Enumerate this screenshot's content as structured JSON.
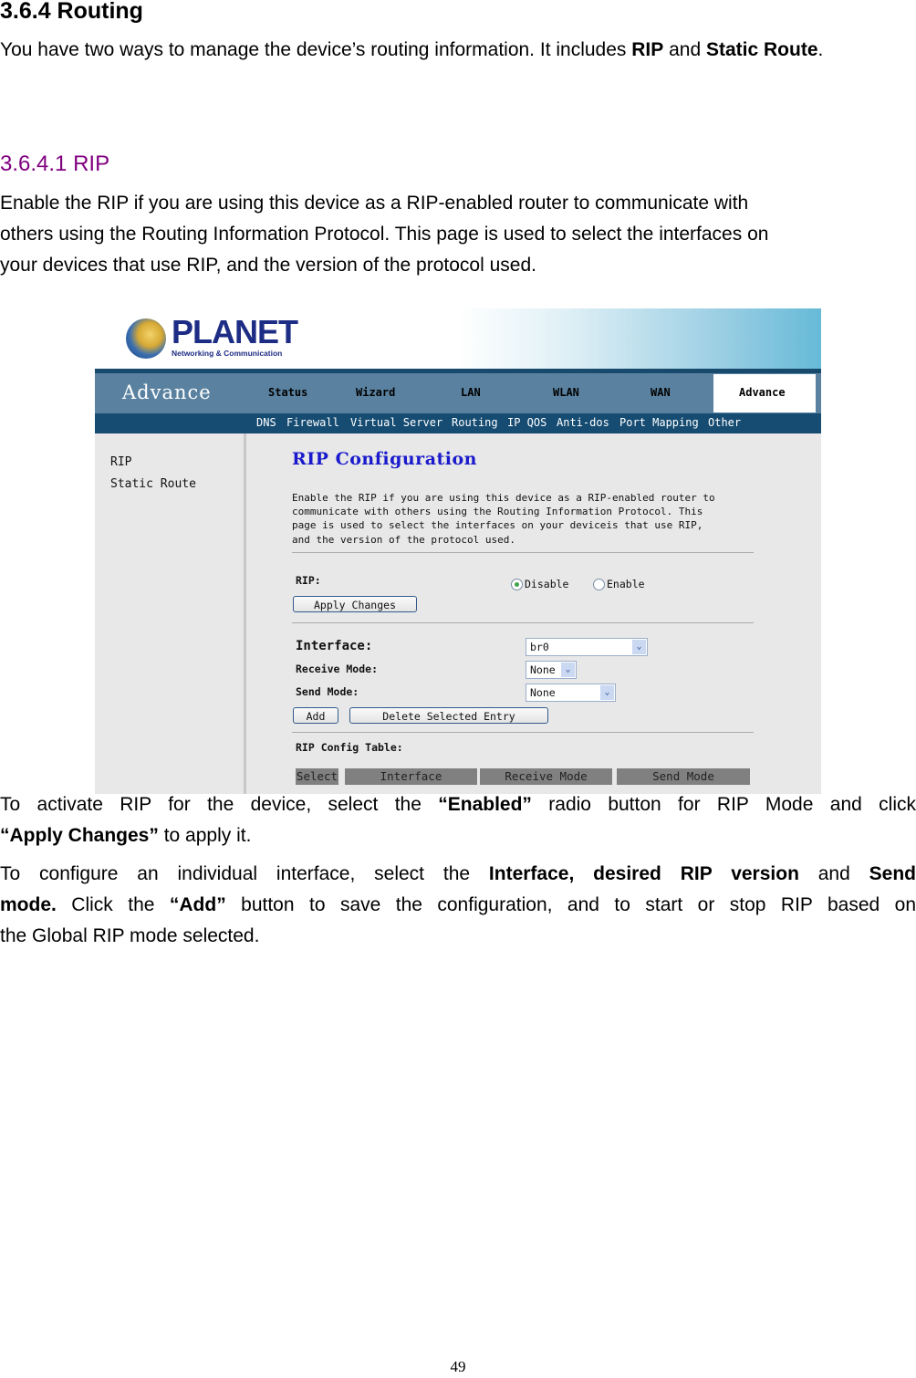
{
  "doc": {
    "heading": "3.6.4 Routing",
    "intro_pre": "You have two ways to manage the device’s routing information. It includes ",
    "intro_rip": "RIP",
    "intro_and": " and ",
    "intro_static": "Static Route",
    "intro_end": ".",
    "subheading": "3.6.4.1 RIP",
    "subheading_color": "#800080",
    "rip_desc_lines": [
      "Enable the RIP if you are using this device as a RIP-enabled router to communicate with",
      "others using the Routing Information Protocol. This page is used to select the interfaces on",
      "your devices that use RIP, and the version of the protocol used."
    ],
    "activate": {
      "t1": "To activate RIP for the device, select the ",
      "b1": "“Enabled”",
      "t2": " radio button for RIP Mode and click",
      "b2": "“Apply Changes”",
      "t3": " to apply it."
    },
    "configure": {
      "t1": "To configure an individual interface, select the ",
      "b1": "Interface, desired RIP version",
      "t2": " and ",
      "b2": "Send",
      "b3": "mode.",
      "t3": " Click the ",
      "b4": "“Add”",
      "t4": " button to save the configuration, and to start or stop RIP based on",
      "t5": "the Global RIP mode selected."
    },
    "page_number": "49"
  },
  "screenshot": {
    "logo": {
      "brand": "PLANET",
      "tagline": "Networking & Communication"
    },
    "nav": {
      "section_title": "Advance",
      "items": [
        "Status",
        "Wizard",
        "LAN",
        "WLAN",
        "WAN"
      ],
      "active": "Advance"
    },
    "subnav": [
      "DNS",
      "Firewall",
      "Virtual Server",
      "Routing",
      "IP QOS",
      "Anti-dos",
      "Port Mapping",
      "Other"
    ],
    "sidebar": [
      "RIP",
      "Static Route"
    ],
    "page": {
      "title": "RIP Configuration",
      "desc": "Enable the RIP if you are using this device as a RIP-enabled router to\ncommunicate with others using the Routing Information Protocol. This\npage is used to select the interfaces on your deviceis that use RIP,\nand the version of the protocol used.",
      "rip_label": "RIP:",
      "radio_disable": "Disable",
      "radio_enable": "Enable",
      "rip_selected": "Disable",
      "apply_button": "Apply Changes",
      "interface_label": "Interface:",
      "interface_value": "br0",
      "receive_label": "Receive Mode:",
      "receive_value": "None",
      "send_label": "Send Mode:",
      "send_value": "None",
      "add_button": "Add",
      "delete_button": "Delete Selected Entry",
      "table_label": "RIP Config Table:",
      "table_headers": [
        "Select",
        "Interface",
        "Receive Mode",
        "Send Mode"
      ]
    },
    "colors": {
      "nav_bg": "#5a82a0",
      "subnav_bg": "#164c72",
      "title_blue": "#1a1acc",
      "table_header_bg": "#808080"
    }
  }
}
